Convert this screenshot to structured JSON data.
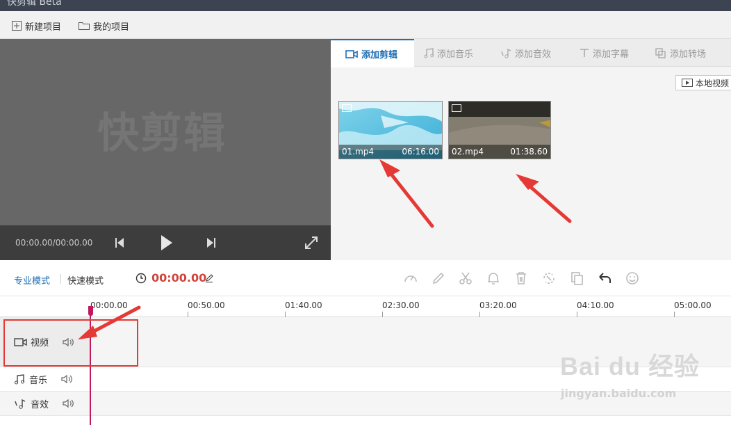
{
  "app": {
    "title": "快剪辑 Beta"
  },
  "menu": {
    "new_project": "新建项目",
    "my_projects": "我的项目"
  },
  "preview": {
    "watermark": "快剪辑",
    "timecode": "00:00.00/00:00.00"
  },
  "tabs": [
    {
      "label": "添加剪辑",
      "icon": "video-camera-icon",
      "active": true
    },
    {
      "label": "添加音乐",
      "icon": "music-note-icon",
      "active": false
    },
    {
      "label": "添加音效",
      "icon": "sound-effect-icon",
      "active": false
    },
    {
      "label": "添加字幕",
      "icon": "text-icon",
      "active": false
    },
    {
      "label": "添加转场",
      "icon": "transition-icon",
      "active": false
    }
  ],
  "local_video_button": "本地视频",
  "clips": [
    {
      "name": "01.mp4",
      "duration": "06:16.00"
    },
    {
      "name": "02.mp4",
      "duration": "01:38.60"
    }
  ],
  "timeline": {
    "mode_pro": "专业模式",
    "mode_quick": "快速模式",
    "current_time": "00:00.00",
    "ticks": [
      "00:00.00",
      "00:50.00",
      "01:40.00",
      "02:30.00",
      "03:20.00",
      "04:10.00",
      "05:00.00"
    ],
    "tracks": [
      {
        "label": "视频",
        "icon": "video-camera-icon"
      },
      {
        "label": "音乐",
        "icon": "music-note-icon"
      },
      {
        "label": "音效",
        "icon": "sound-effect-icon"
      }
    ]
  },
  "watermark_site": {
    "logo": "Bai du 经验",
    "url": "jingyan.baidu.com"
  },
  "colors": {
    "accent": "#1e6fb5",
    "time": "#d0453b",
    "playhead": "#c2185b",
    "annotation": "#e53935"
  }
}
